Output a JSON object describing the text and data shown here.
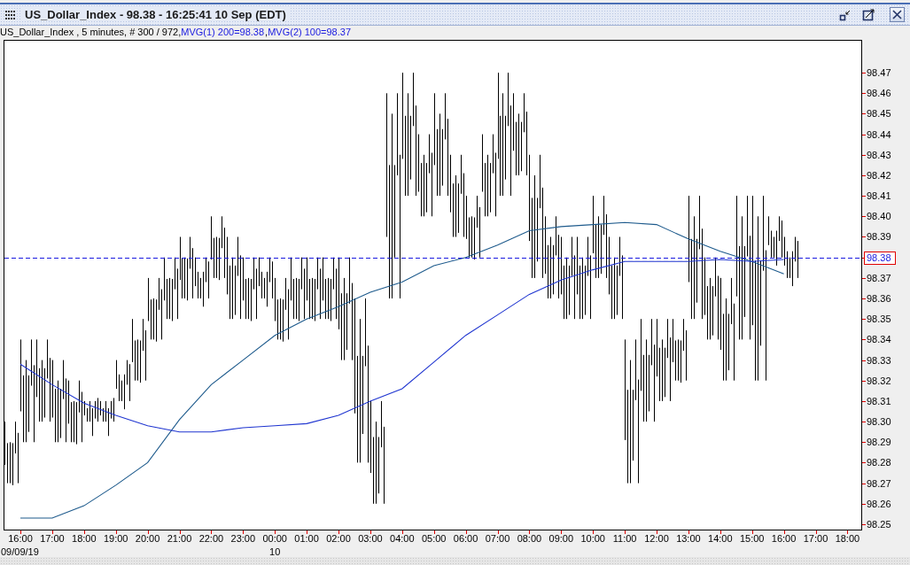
{
  "window": {
    "title": "US_Dollar_Index - 98.38 - 16:25:41  10 Sep (EDT)"
  },
  "legend": {
    "prefix": "US_Dollar_Index , 5 minutes, # 300 / 972,",
    "separator": ","
  },
  "chart": {
    "chart_data": {
      "type": "line",
      "categories": [
        "16:00",
        "17:00",
        "18:00",
        "19:00",
        "20:00",
        "21:00",
        "22:00",
        "23:00",
        "00:00",
        "01:00",
        "02:00",
        "03:00",
        "04:00",
        "05:00",
        "06:00",
        "07:00",
        "08:00",
        "09:00",
        "10:00",
        "11:00",
        "12:00",
        "13:00",
        "14:00",
        "15:00",
        "16:00",
        "17:00",
        "18:00"
      ],
      "series": [
        {
          "name": "MVG(1) 200=98.38",
          "color": "#1d5a8c",
          "values": [
            98.253,
            98.253,
            98.259,
            98.269,
            98.28,
            98.301,
            98.318,
            98.33,
            98.342,
            98.35,
            98.356,
            98.363,
            98.368,
            98.376,
            98.38,
            98.386,
            98.393,
            98.395,
            98.396,
            98.397,
            98.396,
            98.389,
            98.383,
            98.378,
            98.372,
            null,
            null
          ]
        },
        {
          "name": "MVG(2) 100=98.37",
          "color": "#1f35d0",
          "values": [
            98.328,
            98.318,
            98.309,
            98.303,
            98.298,
            98.295,
            98.295,
            98.297,
            98.298,
            98.299,
            98.303,
            98.31,
            98.316,
            98.329,
            98.342,
            98.352,
            98.362,
            98.369,
            98.374,
            98.378,
            98.378,
            98.378,
            98.379,
            98.378,
            98.379,
            null,
            null
          ]
        }
      ],
      "ylim": [
        98.2474,
        98.486
      ],
      "yticks": [
        {
          "value": 98.25,
          "label": "98.25"
        },
        {
          "value": 98.26,
          "label": "98.26"
        },
        {
          "value": 98.27,
          "label": "98.27"
        },
        {
          "value": 98.28,
          "label": "98.28"
        },
        {
          "value": 98.29,
          "label": "98.29"
        },
        {
          "value": 98.3,
          "label": "98.30"
        },
        {
          "value": 98.31,
          "label": "98.31"
        },
        {
          "value": 98.32,
          "label": "98.32"
        },
        {
          "value": 98.33,
          "label": "98.33"
        },
        {
          "value": 98.34,
          "label": "98.34"
        },
        {
          "value": 98.35,
          "label": "98.35"
        },
        {
          "value": 98.36,
          "label": "98.36"
        },
        {
          "value": 98.37,
          "label": "98.37"
        },
        {
          "value": 98.38,
          "label": "98.38"
        },
        {
          "value": 98.39,
          "label": "98.39"
        },
        {
          "value": 98.4,
          "label": "98.40"
        },
        {
          "value": 98.41,
          "label": "98.41"
        },
        {
          "value": 98.42,
          "label": "98.42"
        },
        {
          "value": 98.43,
          "label": "98.43"
        },
        {
          "value": 98.44,
          "label": "98.44"
        },
        {
          "value": 98.45,
          "label": "98.45"
        },
        {
          "value": 98.46,
          "label": "98.46"
        },
        {
          "value": 98.47,
          "label": "98.47"
        }
      ],
      "ref_lines": [
        {
          "axis": "y",
          "value": 98.38
        }
      ]
    },
    "dates": [
      {
        "text": "09/09/19",
        "kind": "day"
      },
      {
        "text": "10",
        "kind": "day"
      }
    ]
  }
}
